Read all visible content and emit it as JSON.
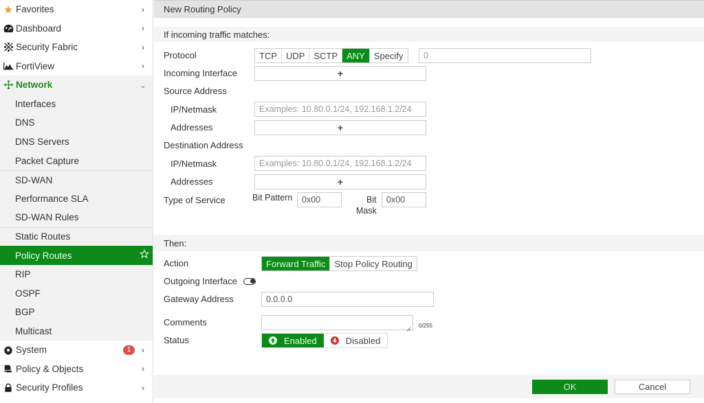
{
  "sidebar": {
    "items": [
      {
        "label": "Favorites",
        "icon": "star-icon"
      },
      {
        "label": "Dashboard",
        "icon": "dashboard-icon"
      },
      {
        "label": "Security Fabric",
        "icon": "security-fabric-icon"
      },
      {
        "label": "FortiView",
        "icon": "fortiview-chart-icon"
      },
      {
        "label": "Network",
        "icon": "network-arrows-icon"
      }
    ],
    "network_sub": [
      {
        "label": "Interfaces"
      },
      {
        "label": "DNS"
      },
      {
        "label": "DNS Servers"
      },
      {
        "label": "Packet Capture"
      },
      {
        "label": "SD-WAN"
      },
      {
        "label": "Performance SLA"
      },
      {
        "label": "SD-WAN Rules"
      },
      {
        "label": "Static Routes"
      },
      {
        "label": "Policy Routes"
      },
      {
        "label": "RIP"
      },
      {
        "label": "OSPF"
      },
      {
        "label": "BGP"
      },
      {
        "label": "Multicast"
      }
    ],
    "bottom_items": [
      {
        "label": "System",
        "icon": "gear-icon",
        "badge": "1"
      },
      {
        "label": "Policy & Objects",
        "icon": "policy-icon"
      },
      {
        "label": "Security Profiles",
        "icon": "lock-icon"
      }
    ],
    "selected": "Policy Routes",
    "accent_color": "#0d8a1a"
  },
  "main": {
    "title": "New Routing Policy",
    "match_section": {
      "header": "If incoming traffic matches:",
      "protocol_label": "Protocol",
      "protocol_options": [
        "TCP",
        "UDP",
        "SCTP",
        "ANY",
        "Specify"
      ],
      "protocol_selected": "ANY",
      "protocol_number": "0",
      "incoming_interface_label": "Incoming Interface",
      "source_address_label": "Source Address",
      "ip_netmask_label": "IP/Netmask",
      "ip_placeholder": "Examples: 10.80.0.1/24, 192.168.1.2/24",
      "addresses_label": "Addresses",
      "destination_address_label": "Destination Address",
      "tos_label": "Type of Service",
      "bit_pattern_label": "Bit Pattern",
      "bit_pattern_value": "0x00",
      "bit_mask_label_1": "Bit",
      "bit_mask_label_2": "Mask",
      "bit_mask_value": "0x00",
      "plus": "+"
    },
    "then_section": {
      "header": "Then:",
      "action_label": "Action",
      "action_options": [
        "Forward Traffic",
        "Stop Policy Routing"
      ],
      "action_selected": "Forward Traffic",
      "outgoing_interface_label": "Outgoing Interface",
      "outgoing_interface_enabled": false,
      "gateway_label": "Gateway Address",
      "gateway_value": "0.0.0.0",
      "comments_label": "Comments",
      "comments_value": "",
      "comments_counter": "0/255",
      "status_label": "Status",
      "status_options": [
        "Enabled",
        "Disabled"
      ],
      "status_selected": "Enabled"
    },
    "footer": {
      "ok_label": "OK",
      "cancel_label": "Cancel"
    }
  }
}
